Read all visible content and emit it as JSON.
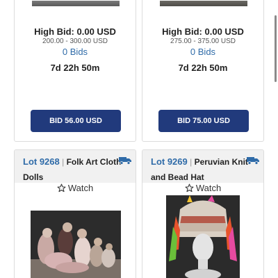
{
  "top_cards": [
    {
      "high_bid": "High Bid: 0.00 USD",
      "estimate": "200.00 - 300.00 USD",
      "bids": "0 Bids",
      "time_left": "7d 22h 50m",
      "bid_button": "BID 56.00 USD"
    },
    {
      "high_bid": "High Bid: 0.00 USD",
      "estimate": "275.00 - 375.00 USD",
      "bids": "0 Bids",
      "time_left": "7d 22h 50m",
      "bid_button": "BID 75.00 USD"
    }
  ],
  "bottom_cards": [
    {
      "lot_number": "Lot 9268",
      "separator": "|",
      "title_line1": "Folk Art Cloth",
      "title_line2": "Dolls",
      "watch_label": "Watch",
      "shipping_icon": "truck-icon"
    },
    {
      "lot_number": "Lot 9269",
      "separator": "|",
      "title_line1": "Peruvian Knit",
      "title_line2": "and Bead Hat",
      "watch_label": "Watch",
      "shipping_icon": "truck-icon"
    }
  ],
  "colors": {
    "button_bg": "#213a7c",
    "link_blue": "#2f6ba8",
    "header_bg": "#f1f1f1"
  }
}
